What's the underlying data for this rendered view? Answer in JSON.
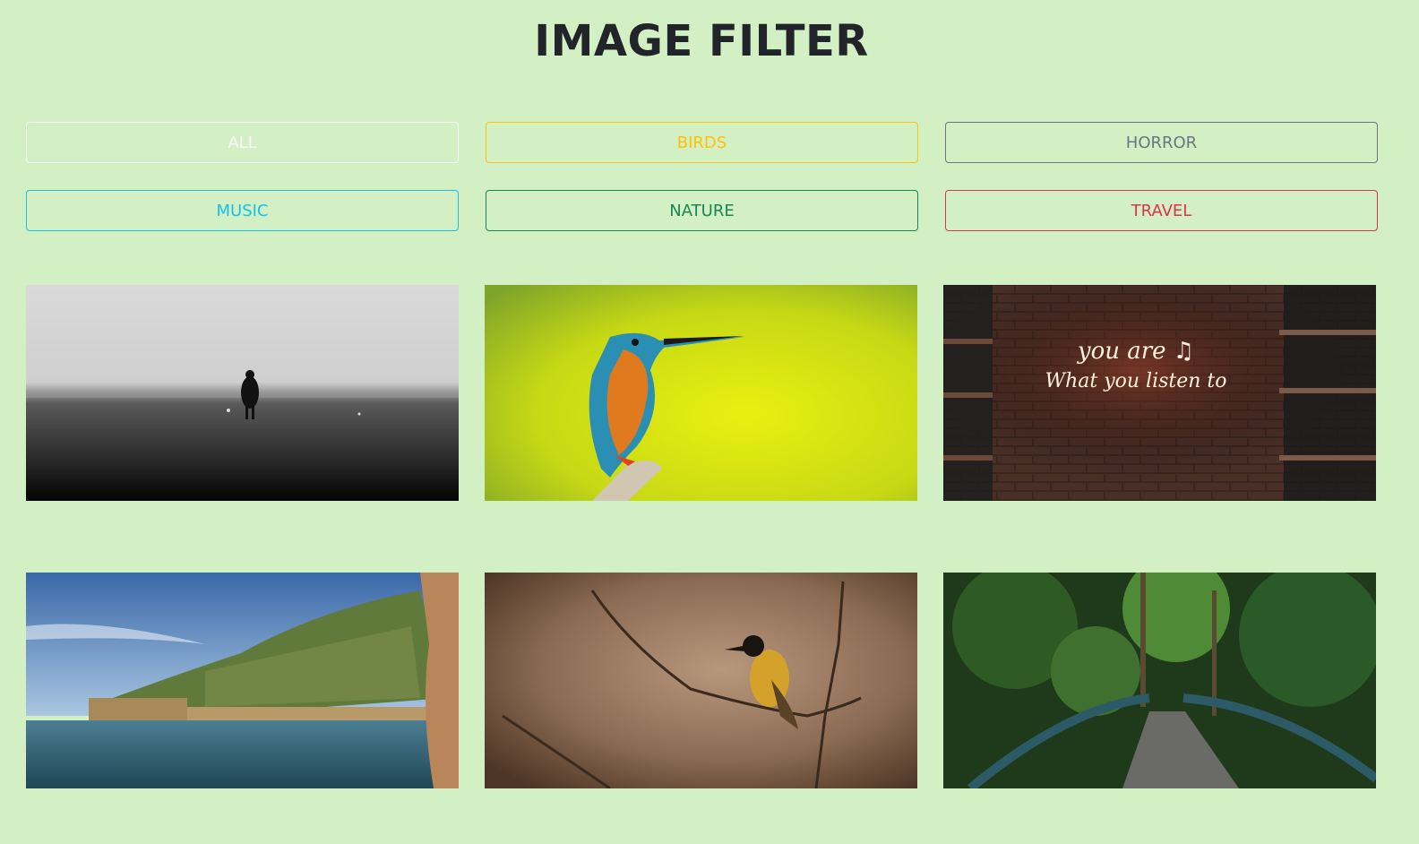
{
  "header": {
    "title": "IMAGE FILTER"
  },
  "filters": [
    {
      "label": "ALL",
      "color": "#f8f9fa"
    },
    {
      "label": "BIRDS",
      "color": "#ffc107"
    },
    {
      "label": "HORROR",
      "color": "#6c757d"
    },
    {
      "label": "MUSIC",
      "color": "#17c1e8"
    },
    {
      "label": "NATURE",
      "color": "#198754"
    },
    {
      "label": "TRAVEL",
      "color": "#dc3545"
    }
  ],
  "gallery": {
    "items": [
      {
        "category": "horror",
        "subject": "figure-in-fog"
      },
      {
        "category": "birds",
        "subject": "kingfisher"
      },
      {
        "category": "music",
        "subject": "neon-sign",
        "sign_line1": "you are ♫",
        "sign_line2": "What you listen to"
      },
      {
        "category": "travel",
        "subject": "coastal-castle"
      },
      {
        "category": "birds",
        "subject": "weaver-bird"
      },
      {
        "category": "nature",
        "subject": "forest-bridge"
      }
    ]
  }
}
